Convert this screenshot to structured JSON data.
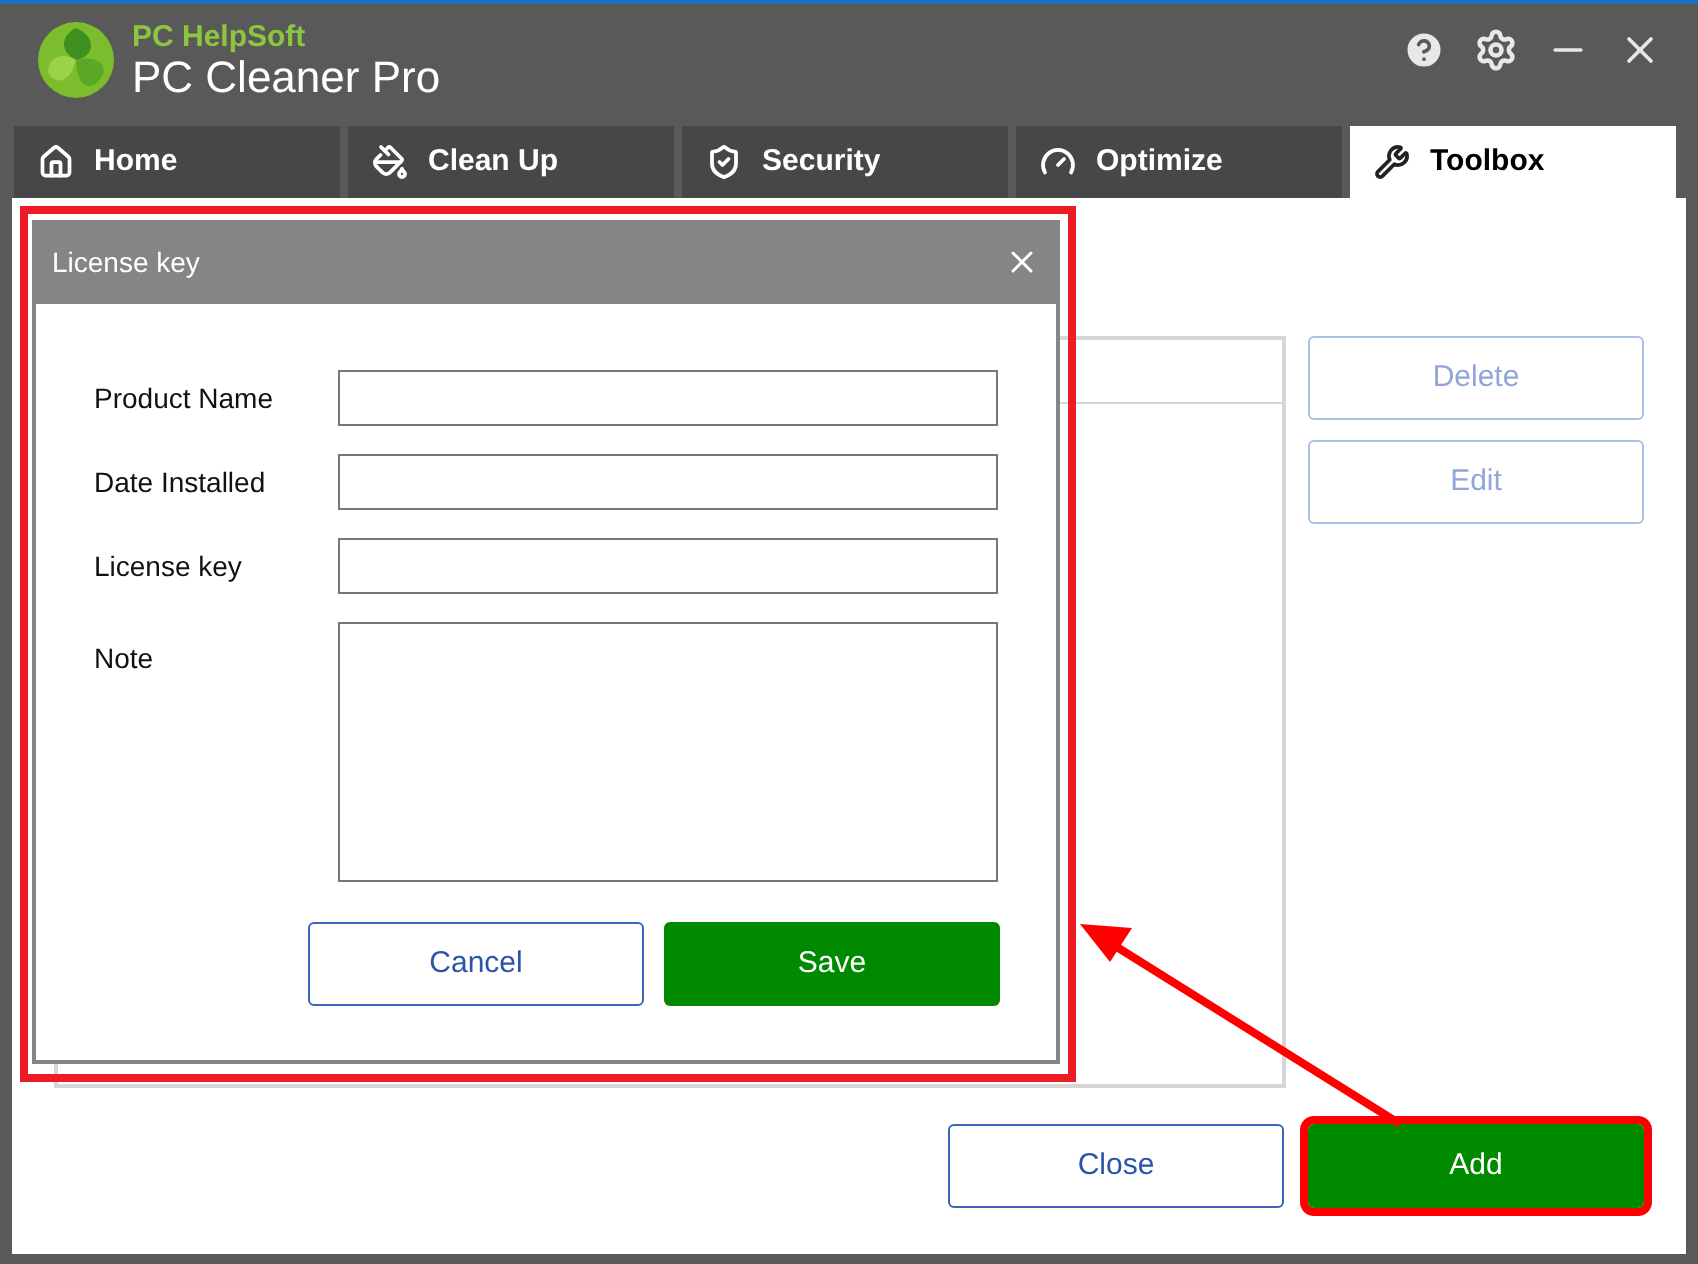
{
  "app": {
    "vendor": "PC HelpSoft",
    "title": "PC Cleaner Pro"
  },
  "tabs": [
    {
      "label": "Home",
      "selected": false
    },
    {
      "label": "Clean Up",
      "selected": false
    },
    {
      "label": "Security",
      "selected": false
    },
    {
      "label": "Optimize",
      "selected": false
    },
    {
      "label": "Toolbox",
      "selected": true
    }
  ],
  "side_buttons": [
    {
      "label": "Delete",
      "disabled": true
    },
    {
      "label": "Edit",
      "disabled": true
    }
  ],
  "footer_buttons": [
    {
      "label": "Close",
      "kind": "outline",
      "highlighted": false
    },
    {
      "label": "Add",
      "kind": "primary",
      "highlighted": true
    }
  ],
  "dialog": {
    "title": "License key",
    "fields": [
      {
        "label": "Product Name",
        "kind": "input"
      },
      {
        "label": "Date Installed",
        "kind": "input"
      },
      {
        "label": "License key",
        "kind": "input"
      },
      {
        "label": "Note",
        "kind": "textarea"
      }
    ],
    "buttons": [
      {
        "label": "Cancel",
        "kind": "outline"
      },
      {
        "label": "Save",
        "kind": "primary"
      }
    ]
  }
}
